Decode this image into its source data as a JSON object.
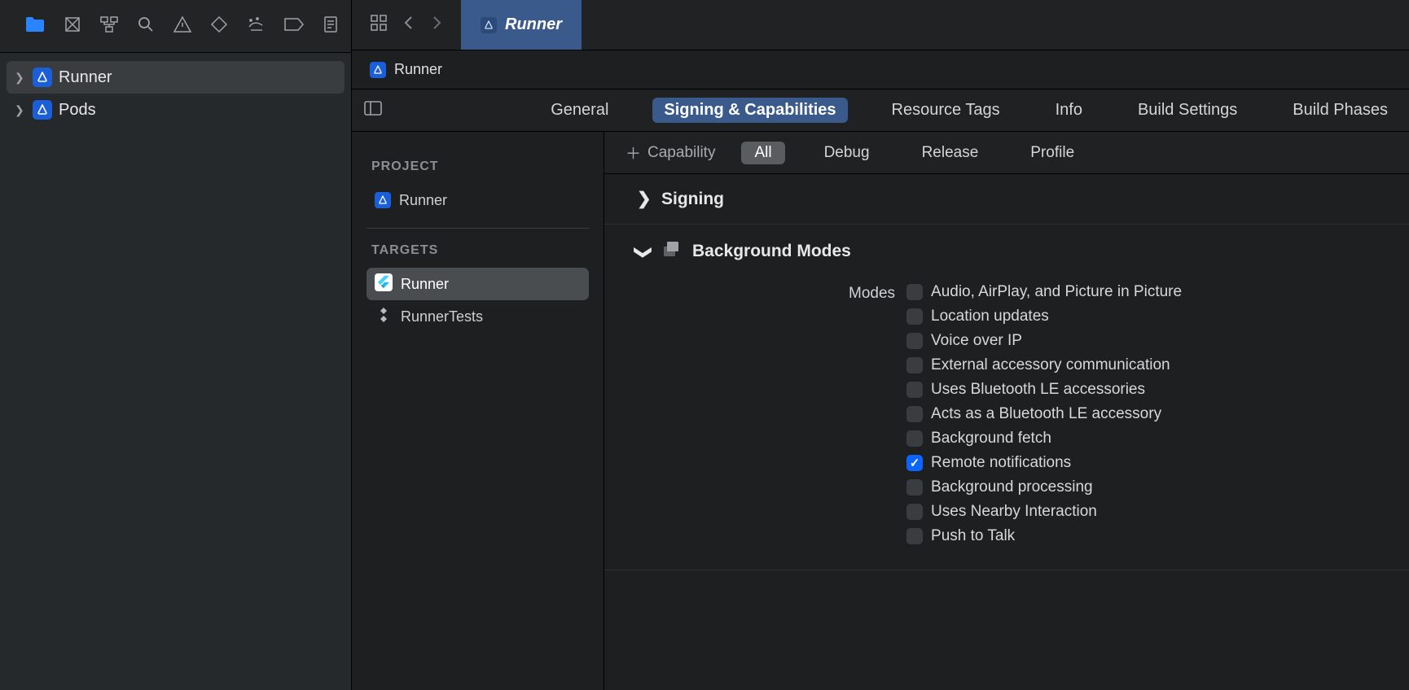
{
  "navigator": {
    "items": [
      {
        "label": "Runner"
      },
      {
        "label": "Pods"
      }
    ]
  },
  "tab": {
    "label": "Runner"
  },
  "breadcrumb": {
    "label": "Runner"
  },
  "configTabs": {
    "general": "General",
    "signing": "Signing & Capabilities",
    "resourceTags": "Resource Tags",
    "info": "Info",
    "buildSettings": "Build Settings",
    "buildPhases": "Build Phases"
  },
  "targetsPane": {
    "projectHeading": "PROJECT",
    "targetsHeading": "TARGETS",
    "project": "Runner",
    "targets": [
      {
        "label": "Runner"
      },
      {
        "label": "RunnerTests"
      }
    ]
  },
  "capsToolbar": {
    "addCapability": "Capability",
    "all": "All",
    "debug": "Debug",
    "release": "Release",
    "profile": "Profile"
  },
  "sections": {
    "signing": "Signing",
    "backgroundModes": "Background Modes",
    "modesLabel": "Modes"
  },
  "modes": [
    {
      "label": "Audio, AirPlay, and Picture in Picture",
      "checked": false
    },
    {
      "label": "Location updates",
      "checked": false
    },
    {
      "label": "Voice over IP",
      "checked": false
    },
    {
      "label": "External accessory communication",
      "checked": false
    },
    {
      "label": "Uses Bluetooth LE accessories",
      "checked": false
    },
    {
      "label": "Acts as a Bluetooth LE accessory",
      "checked": false
    },
    {
      "label": "Background fetch",
      "checked": false
    },
    {
      "label": "Remote notifications",
      "checked": true
    },
    {
      "label": "Background processing",
      "checked": false
    },
    {
      "label": "Uses Nearby Interaction",
      "checked": false
    },
    {
      "label": "Push to Talk",
      "checked": false
    }
  ]
}
